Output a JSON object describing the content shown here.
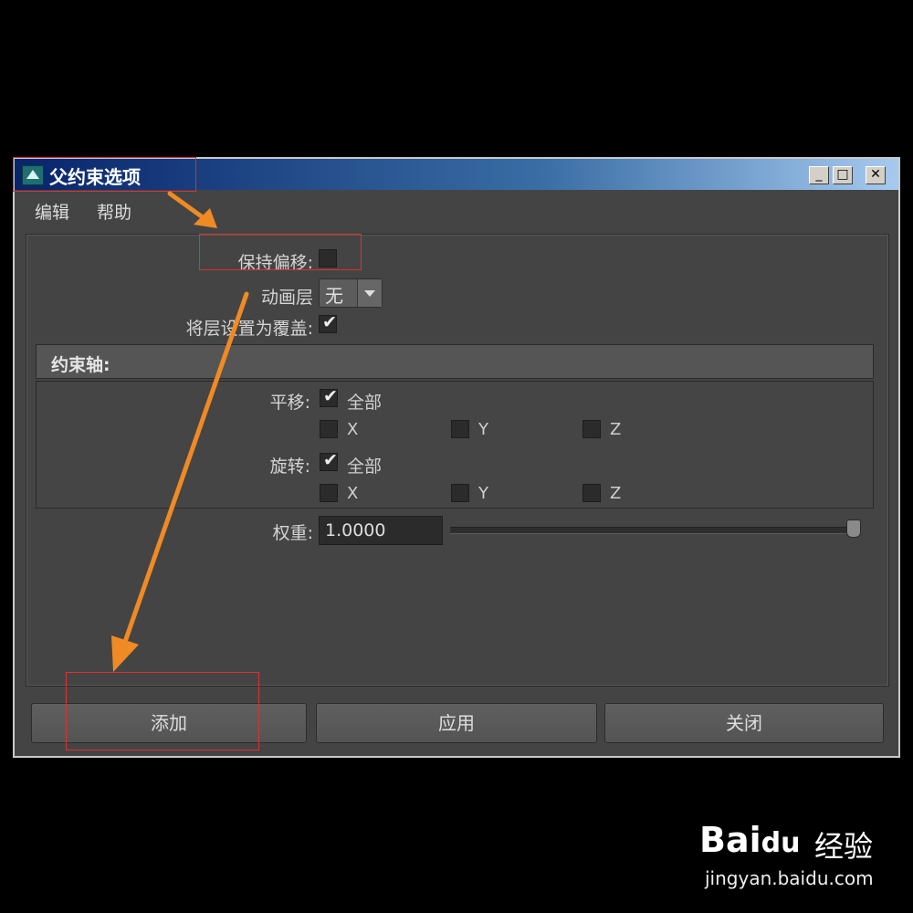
{
  "window": {
    "title": "父约束选项",
    "controls": {
      "minimize": "_",
      "maximize": "□",
      "close": "✕"
    }
  },
  "menu": [
    {
      "label": "编辑"
    },
    {
      "label": "帮助"
    }
  ],
  "options": {
    "maintain_offset_label": "保持偏移:",
    "maintain_offset_checked": false,
    "anim_layer_label": "动画层",
    "anim_layer_value": "无",
    "set_layer_override_label": "将层设置为覆盖:",
    "set_layer_override_checked": true
  },
  "constraint_axes": {
    "section_title": "约束轴:",
    "translate_label": "平移:",
    "translate_all_label": "全部",
    "translate_all_checked": true,
    "rotate_label": "旋转:",
    "rotate_all_label": "全部",
    "rotate_all_checked": true,
    "axes": [
      "X",
      "Y",
      "Z"
    ]
  },
  "weight": {
    "label": "权重:",
    "value": "1.0000",
    "slider_fraction": 1.0
  },
  "buttons": {
    "add": "添加",
    "apply": "应用",
    "close": "关闭"
  },
  "annotation_color": "#f08a24",
  "highlight_color": "#e03030",
  "watermark": {
    "logo": "Bai",
    "logo_paw": "du",
    "text": "经验",
    "url": "jingyan.baidu.com"
  }
}
